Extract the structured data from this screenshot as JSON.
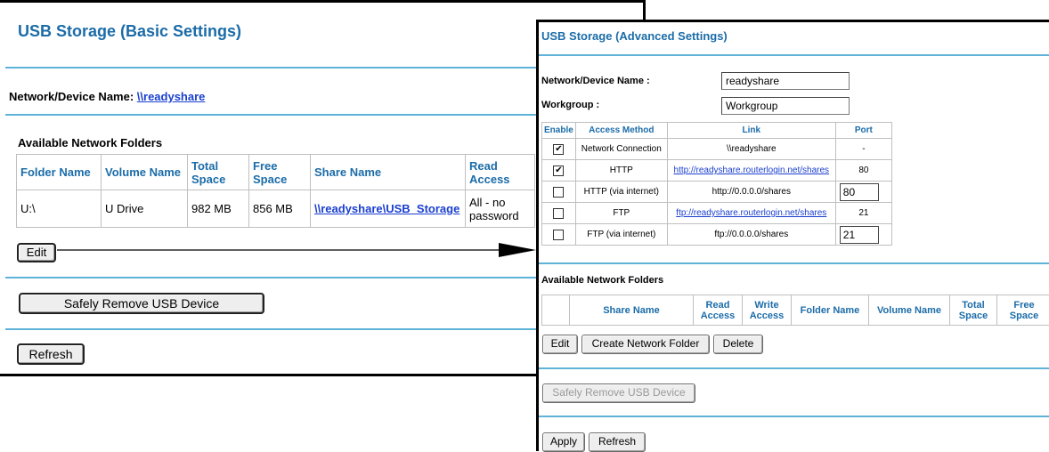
{
  "basic": {
    "title": "USB Storage (Basic Settings)",
    "device_label": "Network/Device Name: ",
    "device_link": "\\\\readyshare",
    "folders_title": "Available Network Folders",
    "columns": [
      "Folder Name",
      "Volume Name",
      "Total Space",
      "Free Space",
      "Share Name",
      "Read Access"
    ],
    "row": {
      "folder": "U:\\",
      "volume": "U Drive",
      "total": "982 MB",
      "free": "856 MB",
      "share": "\\\\readyshare\\USB_Storage",
      "read": "All - no password"
    },
    "edit_label": "Edit",
    "remove_label": "Safely Remove USB Device",
    "refresh_label": "Refresh"
  },
  "advanced": {
    "title": "USB Storage (Advanced Settings)",
    "device_label": "Network/Device Name :",
    "device_value": "readyshare",
    "workgroup_label": "Workgroup :",
    "workgroup_value": "Workgroup",
    "access_columns": [
      "Enable",
      "Access Method",
      "Link",
      "Port"
    ],
    "access_rows": [
      {
        "checked": true,
        "method": "Network Connection",
        "link": "\\\\readyshare",
        "link_is_url": false,
        "port": "-",
        "port_editable": false
      },
      {
        "checked": true,
        "method": "HTTP",
        "link": "http://readyshare.routerlogin.net/shares",
        "link_is_url": true,
        "port": "80",
        "port_editable": false
      },
      {
        "checked": false,
        "method": "HTTP (via internet)",
        "link": "http://0.0.0.0/shares",
        "link_is_url": false,
        "port": "80",
        "port_editable": true
      },
      {
        "checked": false,
        "method": "FTP",
        "link": "ftp://readyshare.routerlogin.net/shares",
        "link_is_url": true,
        "port": "21",
        "port_editable": false
      },
      {
        "checked": false,
        "method": "FTP (via internet)",
        "link": "ftp://0.0.0.0/shares",
        "link_is_url": false,
        "port": "21",
        "port_editable": true
      }
    ],
    "folders_title": "Available Network Folders",
    "folder_columns": [
      "",
      "Share Name",
      "Read Access",
      "Write Access",
      "Folder Name",
      "Volume Name",
      "Total Space",
      "Free Space"
    ],
    "edit_label": "Edit",
    "create_label": "Create Network Folder",
    "delete_label": "Delete",
    "remove_label": "Safely Remove USB Device",
    "apply_label": "Apply",
    "refresh_label": "Refresh"
  },
  "colors": {
    "accent": "#1b6ca8",
    "rule": "#5fb3d8",
    "link": "#1a3fcf"
  }
}
